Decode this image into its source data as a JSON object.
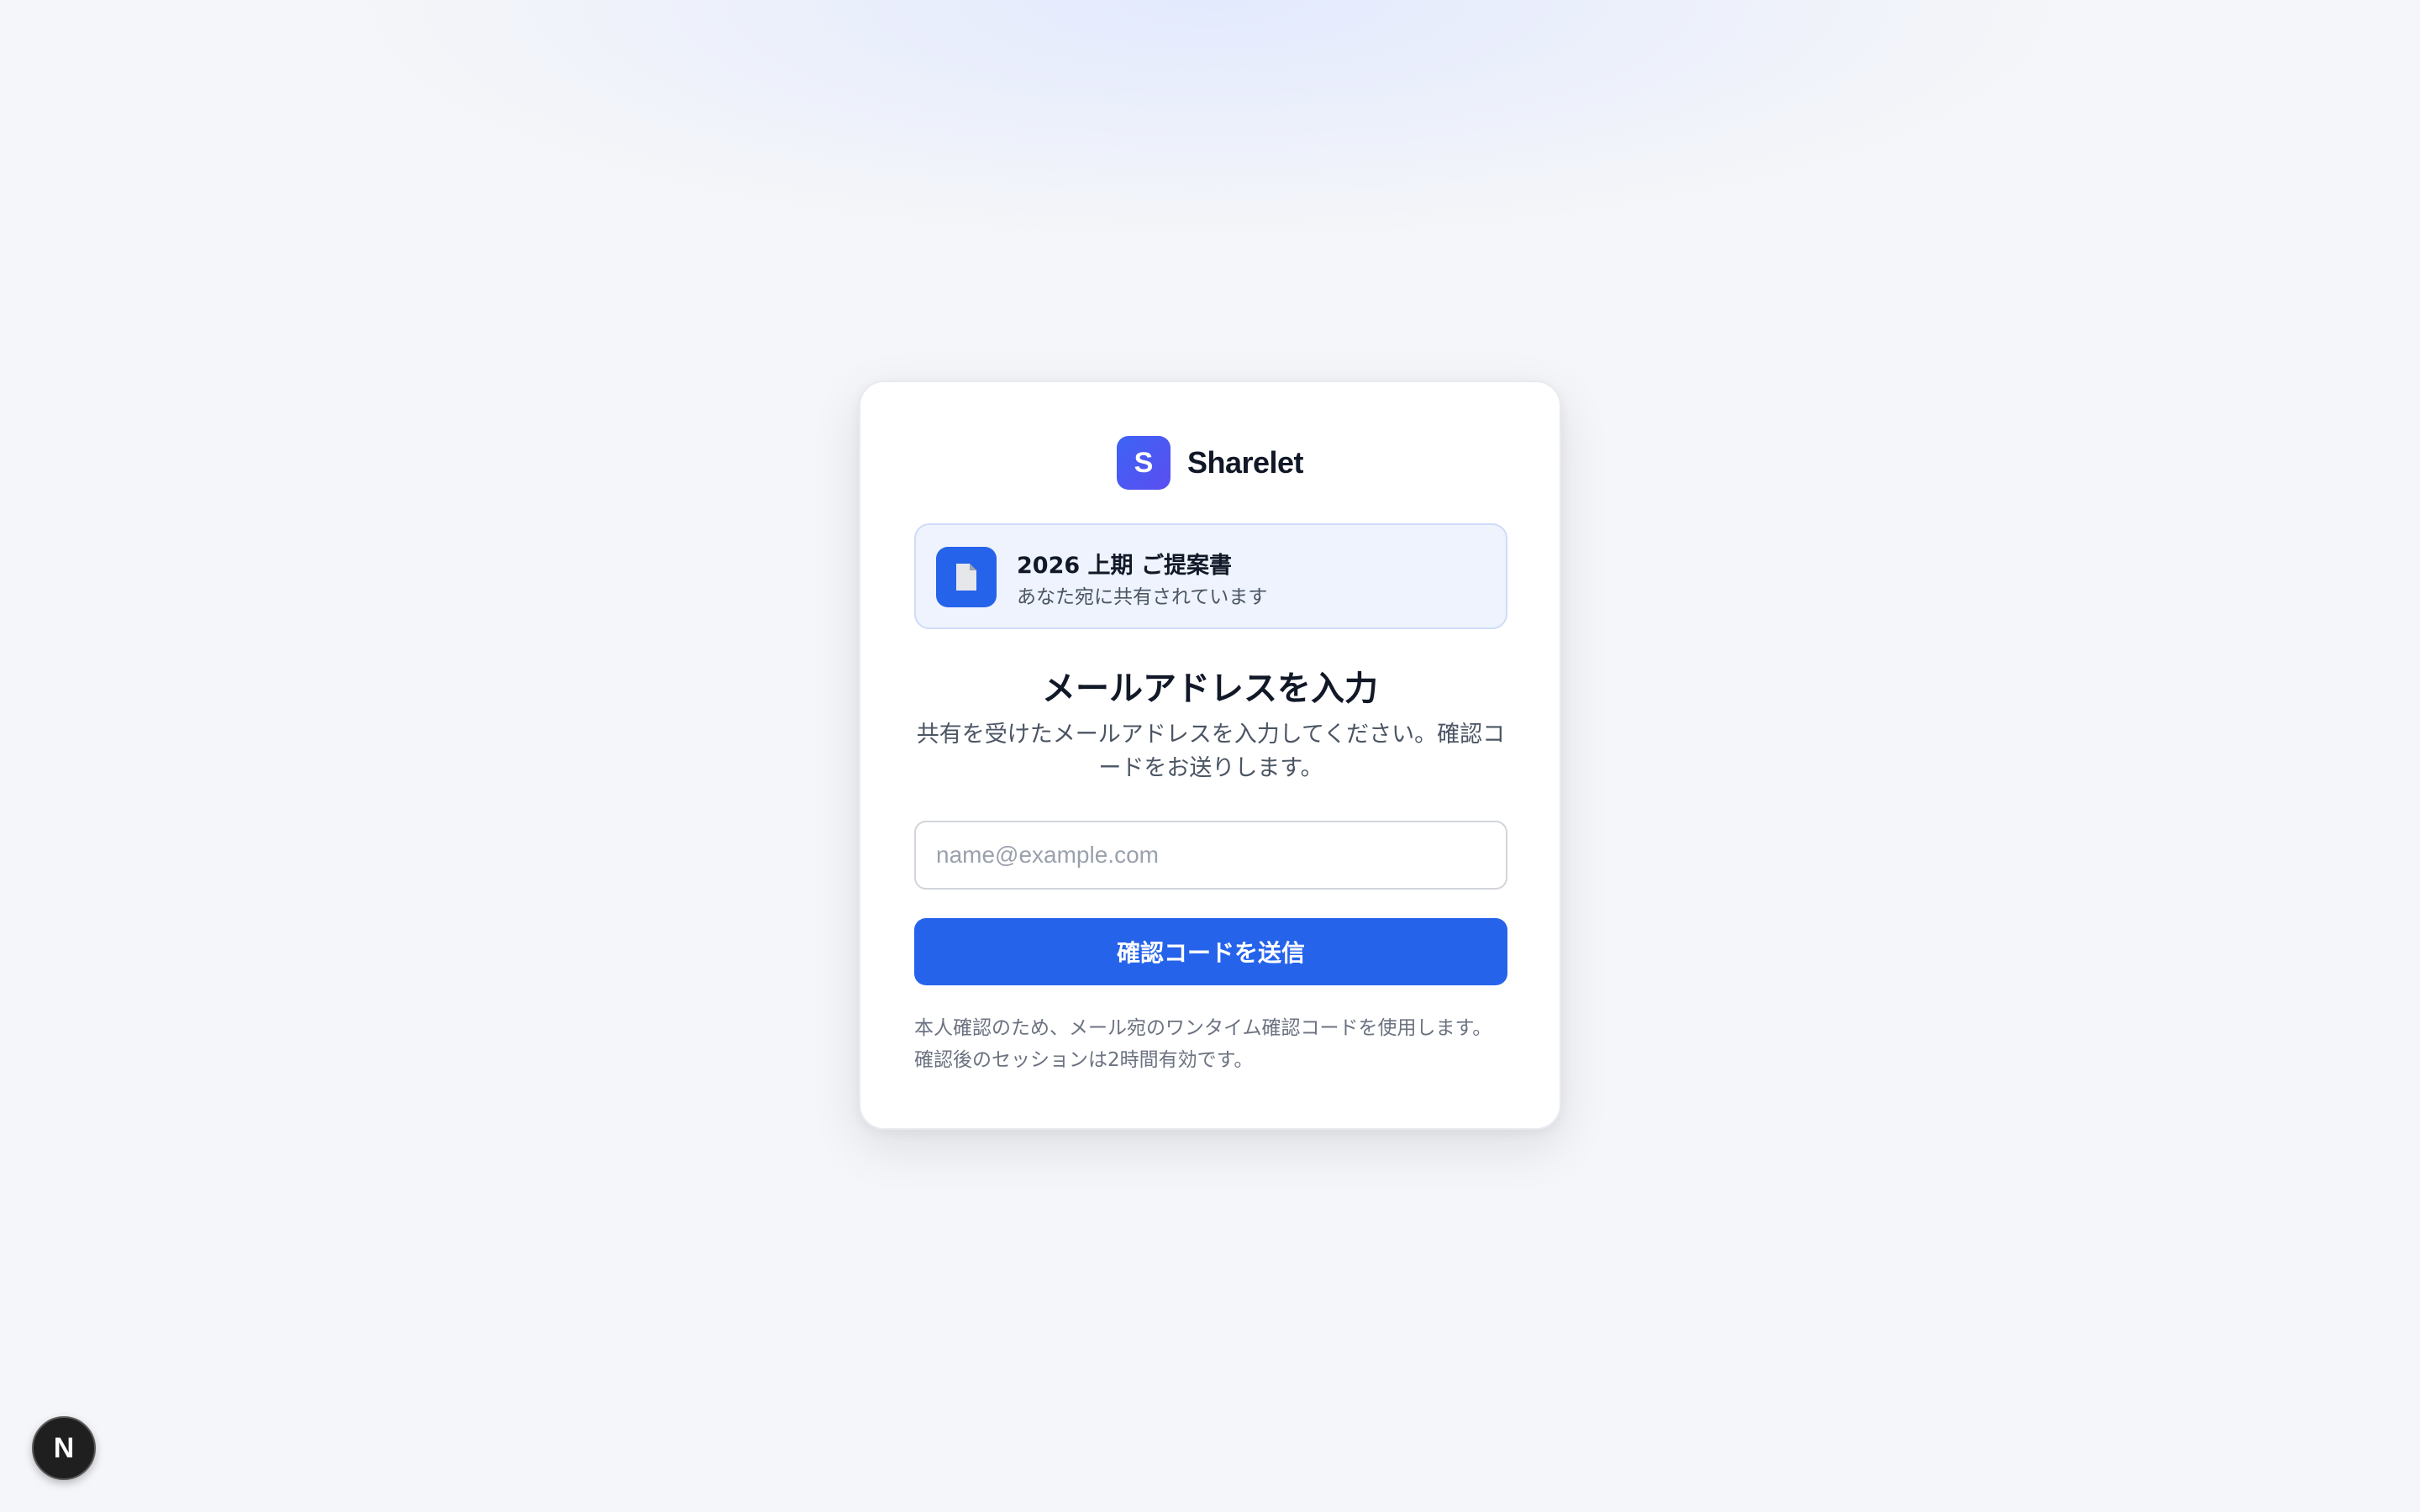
{
  "brand": {
    "logo_letter": "S",
    "name": "Sharelet",
    "accent_color": "#4f5bf0"
  },
  "document": {
    "icon": "file-icon",
    "title": "2026 上期 ご提案書",
    "subtitle": "あなた宛に共有されています"
  },
  "main": {
    "heading": "メールアドレスを入力",
    "description": "共有を受けたメールアドレスを入力してください。確認コードをお送りします。"
  },
  "form": {
    "email_value": "",
    "email_placeholder": "name@example.com",
    "submit_label": "確認コードを送信",
    "button_color": "#2563eb"
  },
  "footer_note": "本人確認のため、メール宛のワンタイム確認コードを使用します。確認後のセッションは2時間有効です。",
  "dev_badge": {
    "icon": "nextjs-icon",
    "letter": "N"
  }
}
